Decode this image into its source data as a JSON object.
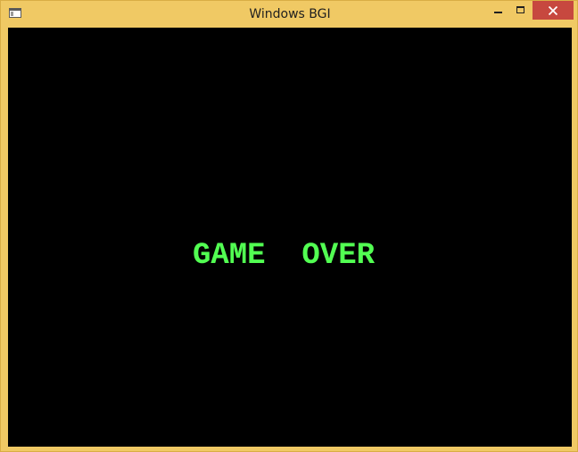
{
  "window": {
    "title": "Windows BGI",
    "icon": "app-window-icon",
    "controls": [
      "minimize-icon",
      "maximize-icon",
      "close-icon"
    ],
    "frame_color": "#f0c964",
    "close_color": "#c7483f"
  },
  "game": {
    "message": "GAME  OVER",
    "message_color": "#52ff52",
    "background_color": "#000000"
  }
}
